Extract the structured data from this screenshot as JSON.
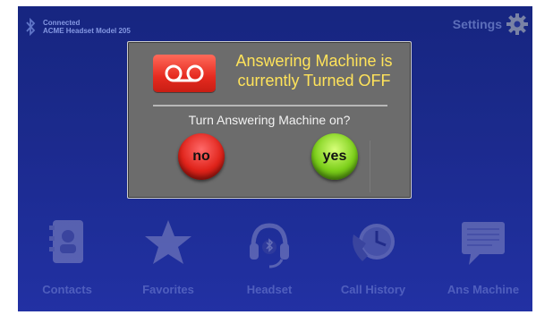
{
  "status": {
    "line1": "Connected",
    "line2": "ACME Headset Model 205"
  },
  "settings": {
    "label": "Settings"
  },
  "dialog": {
    "title_line1": "Answering Machine is",
    "title_line2": "currently Turned OFF",
    "question": "Turn Answering Machine on?",
    "no_label": "no",
    "yes_label": "yes"
  },
  "dock": {
    "items": [
      {
        "label": "Contacts",
        "icon": "contacts-icon"
      },
      {
        "label": "Favorites",
        "icon": "star-icon"
      },
      {
        "label": "Headset",
        "icon": "headset-icon"
      },
      {
        "label": "Call History",
        "icon": "call-history-icon"
      },
      {
        "label": "Ans Machine",
        "icon": "ans-machine-icon"
      }
    ]
  },
  "colors": {
    "background": "#1f2f9a",
    "dialog": "#6c6c6c",
    "title": "#ffe35a",
    "no_button": "#e0231a",
    "yes_button": "#7ccf1a"
  }
}
